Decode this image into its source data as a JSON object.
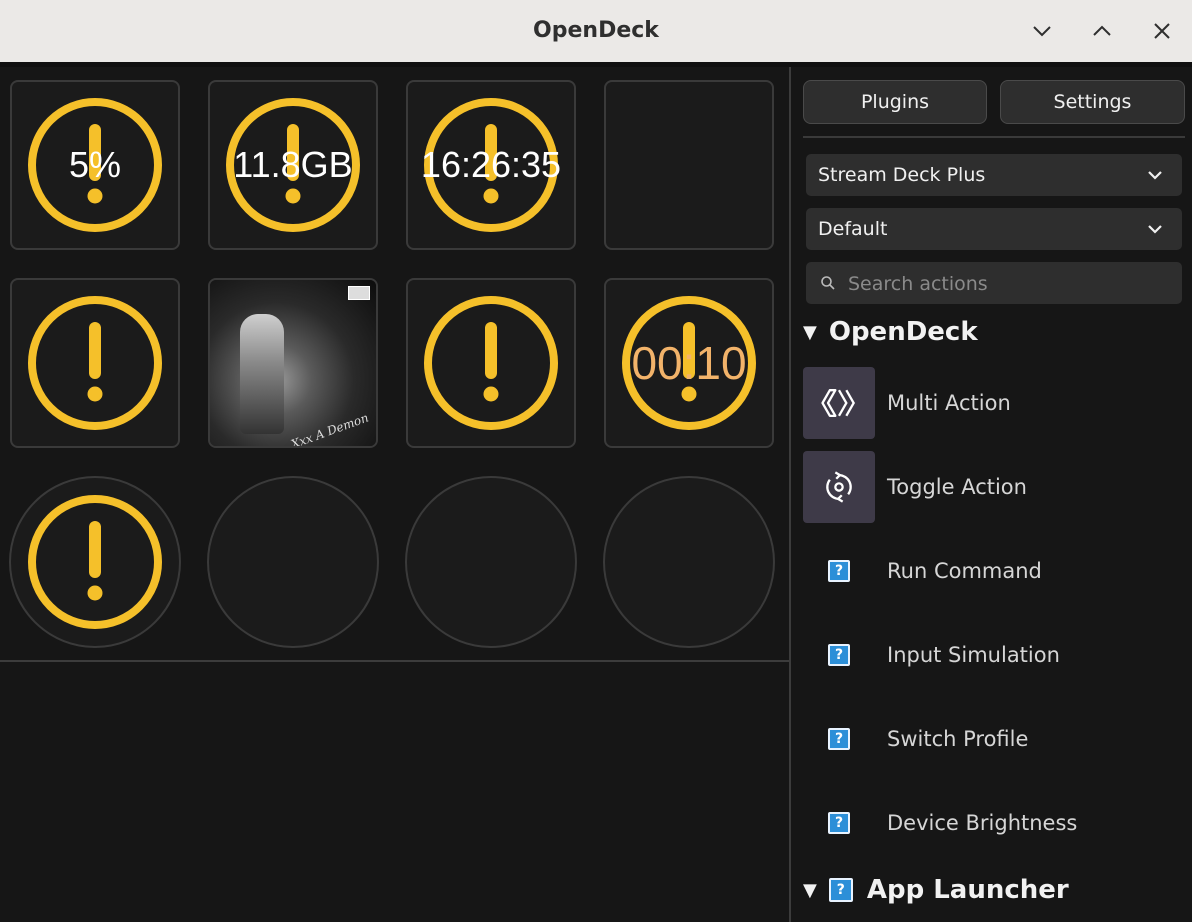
{
  "window": {
    "title": "OpenDeck",
    "controls": [
      "minimize",
      "maximize",
      "close"
    ]
  },
  "keys": [
    {
      "icon": "warning-icon",
      "text": "5%"
    },
    {
      "icon": "warning-icon",
      "text": "11.8GB"
    },
    {
      "icon": "warning-icon",
      "text": "16:26:35"
    },
    {
      "icon": "",
      "text": ""
    },
    {
      "icon": "warning-icon",
      "text": ""
    },
    {
      "icon": "album-art-image",
      "text": ""
    },
    {
      "icon": "warning-icon",
      "text": ""
    },
    {
      "icon": "warning-icon",
      "text": "00:10"
    }
  ],
  "dials": [
    {
      "icon": "warning-icon"
    },
    {
      "icon": ""
    },
    {
      "icon": ""
    },
    {
      "icon": ""
    }
  ],
  "sidebar": {
    "plugins_label": "Plugins",
    "settings_label": "Settings",
    "device_select": "Stream Deck Plus",
    "profile_select": "Default",
    "search_placeholder": "Search actions",
    "categories": [
      {
        "name": "OpenDeck",
        "actions": [
          {
            "label": "Multi Action",
            "icon": "multi-action-icon"
          },
          {
            "label": "Toggle Action",
            "icon": "toggle-action-icon"
          },
          {
            "label": "Run Command",
            "icon": "unknown-icon"
          },
          {
            "label": "Input Simulation",
            "icon": "unknown-icon"
          },
          {
            "label": "Switch Profile",
            "icon": "unknown-icon"
          },
          {
            "label": "Device Brightness",
            "icon": "unknown-icon"
          }
        ]
      },
      {
        "name": "App Launcher",
        "actions": []
      }
    ]
  },
  "colors": {
    "warning": "#f5c02a",
    "timer_text": "#f2b36a",
    "background": "#161616",
    "titlebar": "#ebe9e7"
  },
  "album_art_watermark": "Xxx A Demon"
}
